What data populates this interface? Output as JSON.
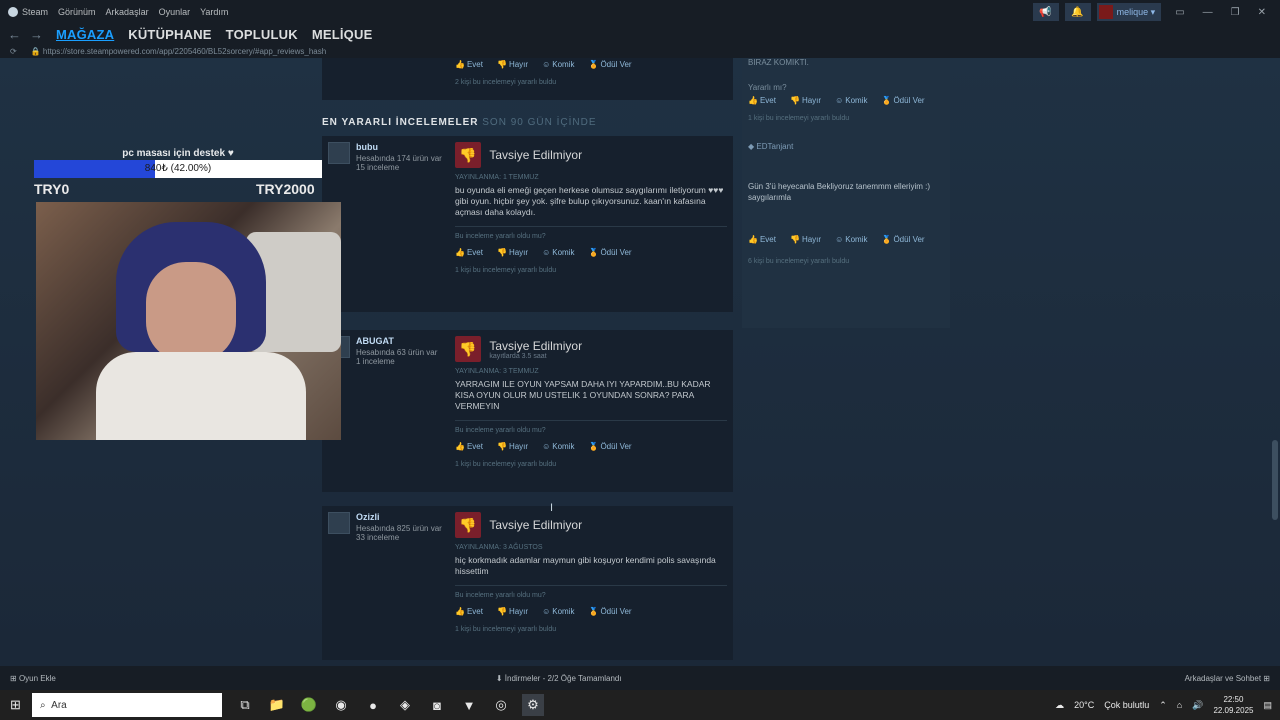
{
  "topbar": {
    "app": "Steam",
    "menu": [
      "Görünüm",
      "Arkadaşlar",
      "Oyunlar",
      "Yardım"
    ],
    "username": "melique"
  },
  "nav": {
    "tabs": [
      "MAĞAZA",
      "KÜTÜPHANE",
      "TOPLULUK",
      "MELİQUE"
    ]
  },
  "url": "https://store.steampowered.com/app/2205460/BL52sorcery/#app_reviews_hash",
  "overlay": {
    "goal_title": "pc masası için destek ♥",
    "progress_text": "840₺ (42.00%)",
    "progress_fraction": 0.42,
    "low": "TRY0",
    "high": "TRY2000"
  },
  "section": {
    "title": "EN YARARLI İNCELEMELER",
    "subtitle": "SON 90 GÜN İÇİNDE"
  },
  "top_partial": {
    "actions": [
      "Evet",
      "Hayır",
      "Komik",
      "Ödül Ver"
    ],
    "helpful": "2 kişi bu incelemeyi yararlı buldu"
  },
  "reviews": [
    {
      "author": "bubu",
      "owned": "Hesabında 174 ürün var",
      "reviews": "15 inceleme",
      "verdict": "Tavsiye Edilmiyor",
      "posted": "YAYINLANMA: 1 TEMMUZ",
      "text": "bu oyunda eli emeği geçen herkese olumsuz saygılarımı iletiyorum ♥♥♥ gibi oyun. hiçbir şey yok. şifre bulup çıkıyorsunuz. kaan'ın kafasına açması daha kolaydı.",
      "helpq": "Bu inceleme yararlı oldu mu?",
      "actions": [
        "Evet",
        "Hayır",
        "Komik",
        "Ödül Ver"
      ],
      "helpful": "1 kişi bu incelemeyi yararlı buldu"
    },
    {
      "author": "ABUGAT",
      "owned": "Hesabında 63 ürün var",
      "reviews": "1 inceleme",
      "verdict": "Tavsiye Edilmiyor",
      "hours": "kayıtlarda 3.5 saat",
      "posted": "YAYINLANMA: 3 TEMMUZ",
      "text": "YARRAGIM ILE OYUN YAPSAM DAHA IYI YAPARDIM..BU KADAR KISA OYUN OLUR MU USTELIK 1 OYUNDAN SONRA? PARA VERMEYIN",
      "helpq": "Bu inceleme yararlı oldu mu?",
      "actions": [
        "Evet",
        "Hayır",
        "Komik",
        "Ödül Ver"
      ],
      "helpful": "1 kişi bu incelemeyi yararlı buldu"
    },
    {
      "author": "Ozizli",
      "owned": "Hesabında 825 ürün var",
      "reviews": "33 inceleme",
      "verdict": "Tavsiye Edilmiyor",
      "posted": "YAYINLANMA: 3 AĞUSTOS",
      "text": "hiç korkmadık adamlar maymun gibi koşuyor kendimi polis savaşında hissettim",
      "helpq": "Bu inceleme yararlı oldu mu?",
      "actions": [
        "Evet",
        "Hayır",
        "Komik",
        "Ödül Ver"
      ],
      "helpful": "1 kişi bu incelemeyi yararlı buldu"
    }
  ],
  "side_panel": {
    "partial_text": "BIRAZ KOMIKTI.",
    "yarali": "Yararlı mı?",
    "actions": [
      "Evet",
      "Hayır",
      "Komik",
      "Ödül Ver"
    ],
    "helpful_1": "1 kişi bu incelemeyi yararlı buldu",
    "comment_author": "EDTanjant",
    "comment_text": "Gün 3'ü heyecanla Bekliyoruz tanemmm elleriyim :) saygılarımla",
    "helpful_2": "6 kişi bu incelemeyi yararlı buldu"
  },
  "bottombar": {
    "add_game": "Oyun Ekle",
    "downloads": "İndirmeler - 2/2 Öğe Tamamlandı",
    "friends": "Arkadaşlar ve Sohbet"
  },
  "taskbar": {
    "search_placeholder": "Ara",
    "weather": "20°C",
    "weather_desc": "Çok bulutlu",
    "time": "22:50",
    "date": "22.09.2025"
  },
  "colors": {
    "accent": "#1a9fff",
    "progress": "#2447d8",
    "thumb_down": "#7a1f2b"
  }
}
